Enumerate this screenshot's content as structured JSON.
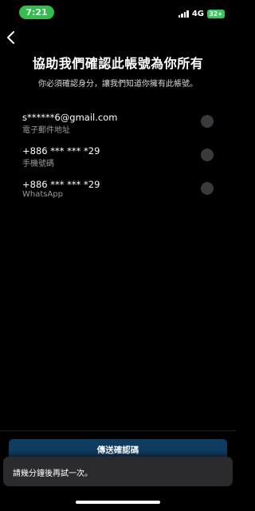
{
  "status_bar": {
    "time": "7:21",
    "network": "4G",
    "battery": "32+"
  },
  "header": {
    "title": "協助我們確認此帳號為你所有",
    "subtitle": "你必須確認身分，讓我們知道你擁有此帳號。"
  },
  "options": [
    {
      "value": "s******6@gmail.com",
      "type_label": "電子郵件地址",
      "selected": false
    },
    {
      "value": "+886 *** *** *29",
      "type_label": "手機號碼",
      "selected": false
    },
    {
      "value": "+886 *** *** *29",
      "type_label": "WhatsApp",
      "selected": false
    }
  ],
  "footer": {
    "send_code_label": "傳送確認碼"
  },
  "toast": {
    "message": "請幾分鐘後再試一次。"
  },
  "colors": {
    "background": "#000000",
    "button": "#0f3d62",
    "toast": "#2b2b2d",
    "radio": "#3a3a3c",
    "time_pill": "#2fbf4a",
    "battery": "#34c759"
  }
}
